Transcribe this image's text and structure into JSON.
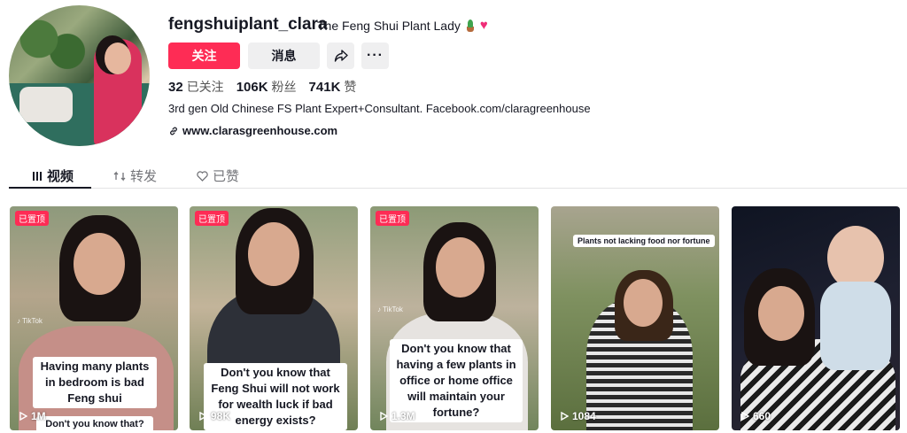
{
  "profile": {
    "username": "fengshuiplant_clara",
    "nickname": "The Feng Shui Plant Lady",
    "follow_label": "关注",
    "message_label": "消息",
    "more_label": "···",
    "stats": {
      "following_count": "32",
      "following_label": "已关注",
      "followers_count": "106K",
      "followers_label": "粉丝",
      "likes_count": "741K",
      "likes_label": "赞"
    },
    "bio": "3rd gen Old Chinese FS Plant Expert+Consultant. Facebook.com/claragreenhouse",
    "link": "www.clarasgreenhouse.com"
  },
  "tabs": [
    {
      "label": "视频",
      "icon": "grid-icon"
    },
    {
      "label": "转发",
      "icon": "repost-icon"
    },
    {
      "label": "已赞",
      "icon": "heart-icon"
    }
  ],
  "videos": [
    {
      "pinned": "已置顶",
      "caption": "Having many plants in bedroom is bad Feng shui",
      "caption2": "Don't you know that?",
      "views": "1M"
    },
    {
      "pinned": "已置顶",
      "caption": "Don't you know that Feng Shui will not work for wealth luck if bad energy exists?",
      "views": "98K"
    },
    {
      "pinned": "已置顶",
      "caption": "Don't you know that having a few plants in office or home office will maintain your fortune?",
      "views": "1.3M"
    },
    {
      "caption": "Plants not lacking food nor fortune",
      "views": "1084"
    },
    {
      "views": "660"
    }
  ],
  "colors": {
    "accent": "#fe2c55",
    "heart": "#ef2c77"
  }
}
